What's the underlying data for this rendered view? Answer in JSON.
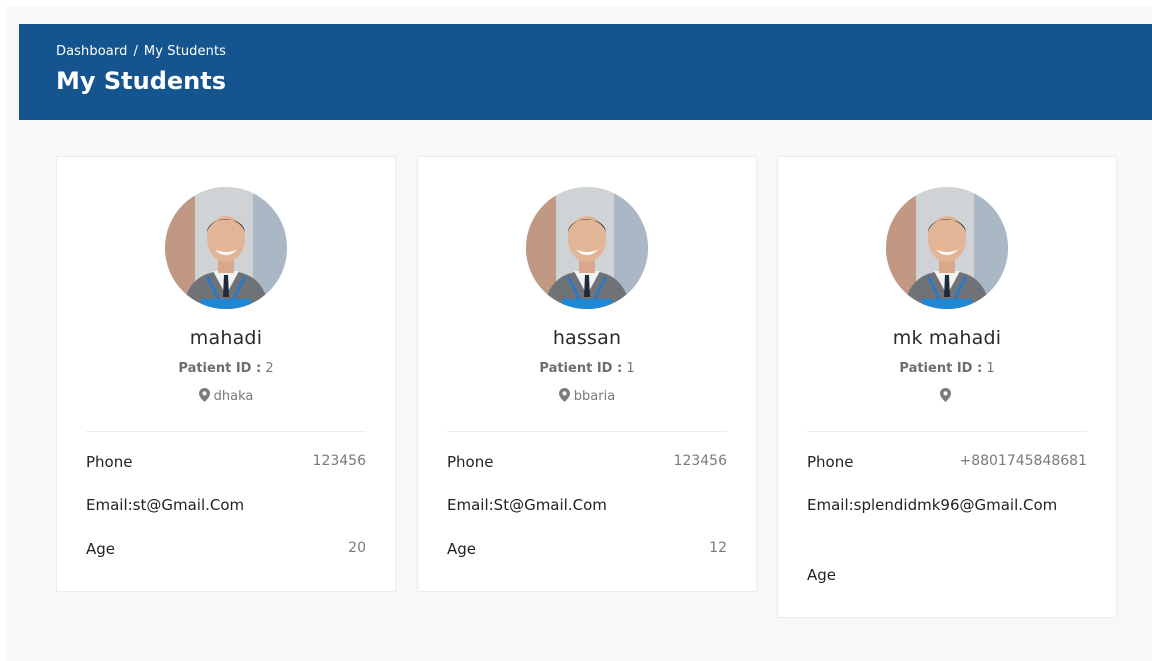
{
  "header": {
    "breadcrumb": {
      "home": "Dashboard",
      "separator": "/",
      "current": "My Students"
    },
    "title": "My Students",
    "bg_color": "#15558f"
  },
  "students": [
    {
      "name": "mahadi",
      "patient_id_label": "Patient ID :",
      "patient_id": "2",
      "location": "dhaka",
      "phone_label": "Phone",
      "phone": "123456",
      "email": "Email:st@Gmail.Com",
      "age_label": "Age",
      "age": "20"
    },
    {
      "name": "hassan",
      "patient_id_label": "Patient ID :",
      "patient_id": "1",
      "location": "bbaria",
      "phone_label": "Phone",
      "phone": "123456",
      "email": "Email:St@Gmail.Com",
      "age_label": "Age",
      "age": "12"
    },
    {
      "name": "mk mahadi",
      "patient_id_label": "Patient ID :",
      "patient_id": "1",
      "location": "",
      "phone_label": "Phone",
      "phone": "+8801745848681",
      "email": "Email:splendidmk96@Gmail.Com",
      "age_label": "Age",
      "age": ""
    }
  ],
  "icons": {
    "location": "map-pin-icon",
    "avatar": "profile-photo"
  }
}
